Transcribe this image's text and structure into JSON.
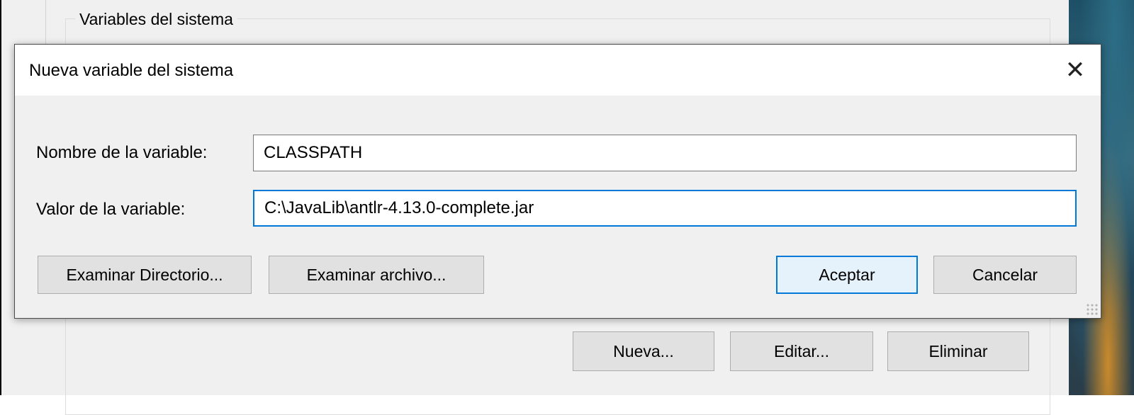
{
  "parent_window": {
    "group_title": "Variables del sistema",
    "buttons": {
      "new": "Nueva...",
      "edit": "Editar...",
      "delete": "Eliminar"
    }
  },
  "dialog": {
    "title": "Nueva variable del sistema",
    "close_icon": "close-icon",
    "fields": {
      "name_label": "Nombre de la variable:",
      "name_value": "CLASSPATH",
      "value_label": "Valor de la variable:",
      "value_value": "C:\\JavaLib\\antlr-4.13.0-complete.jar"
    },
    "buttons": {
      "browse_directory": "Examinar Directorio...",
      "browse_file": "Examinar archivo...",
      "ok": "Aceptar",
      "cancel": "Cancelar"
    }
  },
  "colors": {
    "focus_accent": "#0078d7",
    "window_bg": "#f0f0f0",
    "button_bg": "#e1e1e1"
  }
}
